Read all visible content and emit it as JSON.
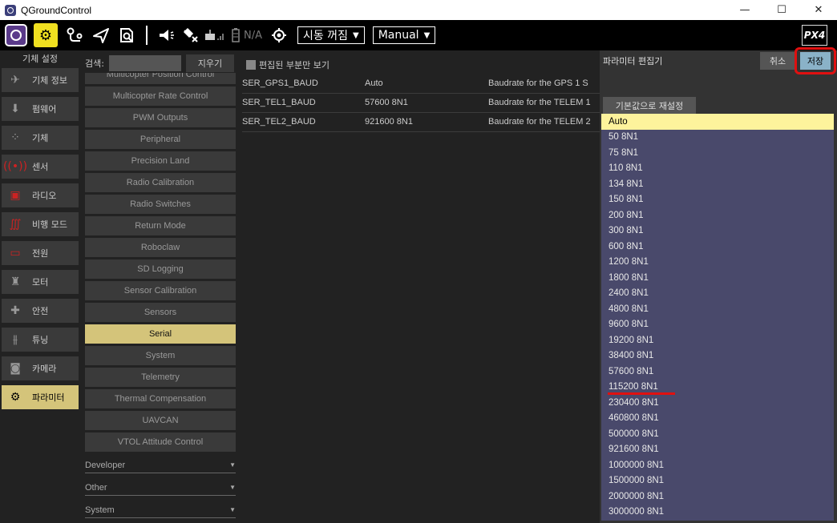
{
  "window": {
    "title": "QGroundControl",
    "minimize": "—",
    "maximize": "☐",
    "close": "✕"
  },
  "toolbar": {
    "na_label": "N/A",
    "arm_mode": "시동 꺼짐",
    "flight_mode": "Manual",
    "logo_text": "PX4"
  },
  "sidebar": {
    "header": "기체 설정",
    "items": [
      {
        "label": "기체 정보",
        "icon": "plane-icon"
      },
      {
        "label": "펌웨어",
        "icon": "download-icon"
      },
      {
        "label": "기체",
        "icon": "airframe-icon"
      },
      {
        "label": "센서",
        "icon": "sensor-icon"
      },
      {
        "label": "라디오",
        "icon": "radio-icon"
      },
      {
        "label": "비행 모드",
        "icon": "flight-modes-icon"
      },
      {
        "label": "전원",
        "icon": "battery-icon"
      },
      {
        "label": "모터",
        "icon": "motor-icon"
      },
      {
        "label": "안전",
        "icon": "safety-icon"
      },
      {
        "label": "튜닝",
        "icon": "tuning-icon"
      },
      {
        "label": "카메라",
        "icon": "camera-icon"
      },
      {
        "label": "파라미터",
        "icon": "parameters-icon"
      }
    ],
    "active_index": 11
  },
  "search": {
    "label": "검색:",
    "value": "",
    "clear_label": "지우기",
    "modified_only_label": "편집된 부분만 보기"
  },
  "groups": {
    "items": [
      "Multicopter Position Control",
      "Multicopter Rate Control",
      "PWM Outputs",
      "Peripheral",
      "Precision Land",
      "Radio Calibration",
      "Radio Switches",
      "Return Mode",
      "Roboclaw",
      "SD Logging",
      "Sensor Calibration",
      "Sensors",
      "Serial",
      "System",
      "Telemetry",
      "Thermal Compensation",
      "UAVCAN",
      "VTOL Attitude Control"
    ],
    "active": "Serial",
    "categories": [
      "Developer",
      "Other",
      "System"
    ]
  },
  "params": [
    {
      "name": "SER_GPS1_BAUD",
      "value": "Auto",
      "desc": "Baudrate for the GPS 1 S"
    },
    {
      "name": "SER_TEL1_BAUD",
      "value": "57600 8N1",
      "desc": "Baudrate for the TELEM 1"
    },
    {
      "name": "SER_TEL2_BAUD",
      "value": "921600 8N1",
      "desc": "Baudrate for the TELEM 2"
    }
  ],
  "editor": {
    "title": "파라미터 편집기",
    "cancel_label": "취소",
    "save_label": "저장",
    "reset_label": "기본값으로 재설정",
    "options": [
      "Auto",
      "50 8N1",
      "75 8N1",
      "110 8N1",
      "134 8N1",
      "150 8N1",
      "200 8N1",
      "300 8N1",
      "600 8N1",
      "1200 8N1",
      "1800 8N1",
      "2400 8N1",
      "4800 8N1",
      "9600 8N1",
      "19200 8N1",
      "38400 8N1",
      "57600 8N1",
      "115200 8N1",
      "230400 8N1",
      "460800 8N1",
      "500000 8N1",
      "921600 8N1",
      "1000000 8N1",
      "1500000 8N1",
      "2000000 8N1",
      "3000000 8N1"
    ],
    "selected_option": "Auto",
    "underlined_option": "115200 8N1"
  },
  "colors": {
    "accent_yellow": "#d4c47a",
    "selected_option": "#fdf39c",
    "highlight_red": "#e01010",
    "save_blue": "#8ab2c8"
  }
}
